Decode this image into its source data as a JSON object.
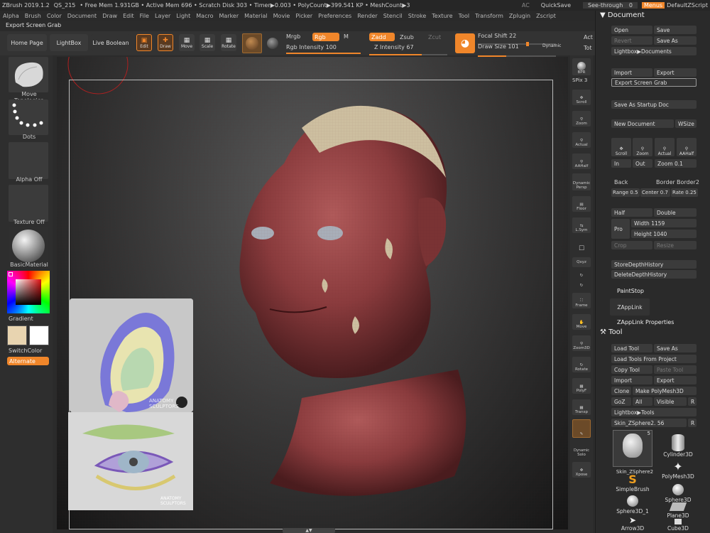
{
  "title_bar": {
    "app": "ZBrush 2019.1.2",
    "file": "QS_215",
    "stats": "• Free Mem 1.931GB • Active Mem 696 • Scratch Disk 303 • Timer▶0.003 • PolyCount▶399.541 KP • MeshCount▶3",
    "ac": "AC",
    "quicksave": "QuickSave",
    "see_through": "See-through",
    "see_through_value": "0",
    "menus": "Menus",
    "script": "DefaultZScript"
  },
  "menu_items": [
    "Alpha",
    "Brush",
    "Color",
    "Document",
    "Draw",
    "Edit",
    "File",
    "Layer",
    "Light",
    "Macro",
    "Marker",
    "Material",
    "Movie",
    "Picker",
    "Preferences",
    "Render",
    "Stencil",
    "Stroke",
    "Texture",
    "Tool",
    "Transform",
    "Zplugin",
    "Zscript"
  ],
  "shelf": {
    "export_label": "Export Screen Grab",
    "home_page": "Home Page",
    "lightbox": "LightBox",
    "live_boolean": "Live Boolean",
    "edit": "Edit",
    "draw": "Draw",
    "move": "Move",
    "scale": "Scale",
    "rotate": "Rotate",
    "mrgb": "Mrgb",
    "rgb": "Rgb",
    "m": "M",
    "zadd": "Zadd",
    "zsub": "Zsub",
    "zcut": "Zcut",
    "rgb_intensity_label": "Rgb Intensity",
    "rgb_intensity": "100",
    "z_intensity_label": "Z Intensity",
    "z_intensity": "67",
    "focal_shift_label": "Focal Shift",
    "focal_shift": "22",
    "draw_size_label": "Draw Size",
    "draw_size": "101",
    "dynamic": "Dynamic",
    "act": "Act",
    "tot": "Tot"
  },
  "left_tray": {
    "brush": "Move Topologica",
    "stroke": "Dots",
    "alpha": "Alpha Off",
    "texture": "Texture Off",
    "material": "BasicMaterial",
    "gradient": "Gradient",
    "switch_color": "SwitchColor",
    "alternate": "Alternate"
  },
  "right_column": {
    "bpr": "BPR",
    "spix_label": "SPix",
    "spix": "3",
    "scroll": "Scroll",
    "zoom": "Zoom",
    "actual": "Actual",
    "aahalf": "AAHalf",
    "dynamic": "Dynamic",
    "persp": "Persp",
    "floor": "Floor",
    "lsym": "L.Sym",
    "xyz": "Qxyz",
    "frame": "Frame",
    "move": "Move",
    "zoom3d": "Zoom3D",
    "rotate": "Rotate",
    "polyf": "PolyF",
    "transp": "Transp",
    "solo": "Solo",
    "xpose": "Xpose"
  },
  "document_palette": {
    "header": "Document",
    "open": "Open",
    "save": "Save",
    "revert": "Revert",
    "save_as": "Save As",
    "lightbox_docs": "Lightbox▶Documents",
    "import": "Import",
    "export": "Export",
    "export_screen_grab": "Export Screen Grab",
    "save_startup": "Save As Startup Doc",
    "new_document": "New Document",
    "wsize": "WSize",
    "scroll": "Scroll",
    "zoom": "Zoom",
    "actual": "Actual",
    "aahalf": "AAHalf",
    "in": "In",
    "out": "Out",
    "zoom_label": "Zoom",
    "zoom_value": "0.1",
    "back": "Back",
    "border": "Border",
    "border2": "Border2",
    "range_label": "Range",
    "range": "0.5",
    "center_label": "Center",
    "center": "0.7",
    "rate_label": "Rate",
    "rate": "0.25",
    "half": "Half",
    "double": "Double",
    "pro": "Pro",
    "width_label": "Width",
    "width": "1159",
    "height_label": "Height",
    "height": "1040",
    "crop": "Crop",
    "resize": "Resize",
    "store_depth": "StoreDepthHistory",
    "delete_depth": "DeleteDepthHistory",
    "paintstop": "PaintStop",
    "zapplink": "ZAppLink",
    "zapplink_props": "ZAppLink Properties"
  },
  "tool_palette": {
    "header": "Tool",
    "load_tool": "Load Tool",
    "save_as": "Save As",
    "load_from_project": "Load Tools From Project",
    "copy_tool": "Copy Tool",
    "paste_tool": "Paste Tool",
    "import": "Import",
    "export": "Export",
    "clone": "Clone",
    "make_polymesh": "Make PolyMesh3D",
    "goz": "GoZ",
    "all": "All",
    "visible": "Visible",
    "r": "R",
    "lightbox_tools": "Lightbox▶Tools",
    "current_tool": "Skin_ZSphere2.",
    "current_value": "56",
    "tool_count": "5",
    "tools": [
      "Skin_ZSphere2",
      "Cylinder3D",
      "PolyMesh3D",
      "SimpleBrush",
      "Sphere3D",
      "Sphere3D_1",
      "Plane3D",
      "Arrow3D",
      "Cube3D"
    ]
  },
  "reference_images": {
    "ear_watermark": "ANATOMY SCULPTORS",
    "eye_watermark": "ANATOMY SCULPTORS"
  },
  "colors": {
    "accent": "#f0862a",
    "background": "#2b2b2b",
    "panel": "#3a3a3a",
    "skin": "#8e3b3d"
  }
}
